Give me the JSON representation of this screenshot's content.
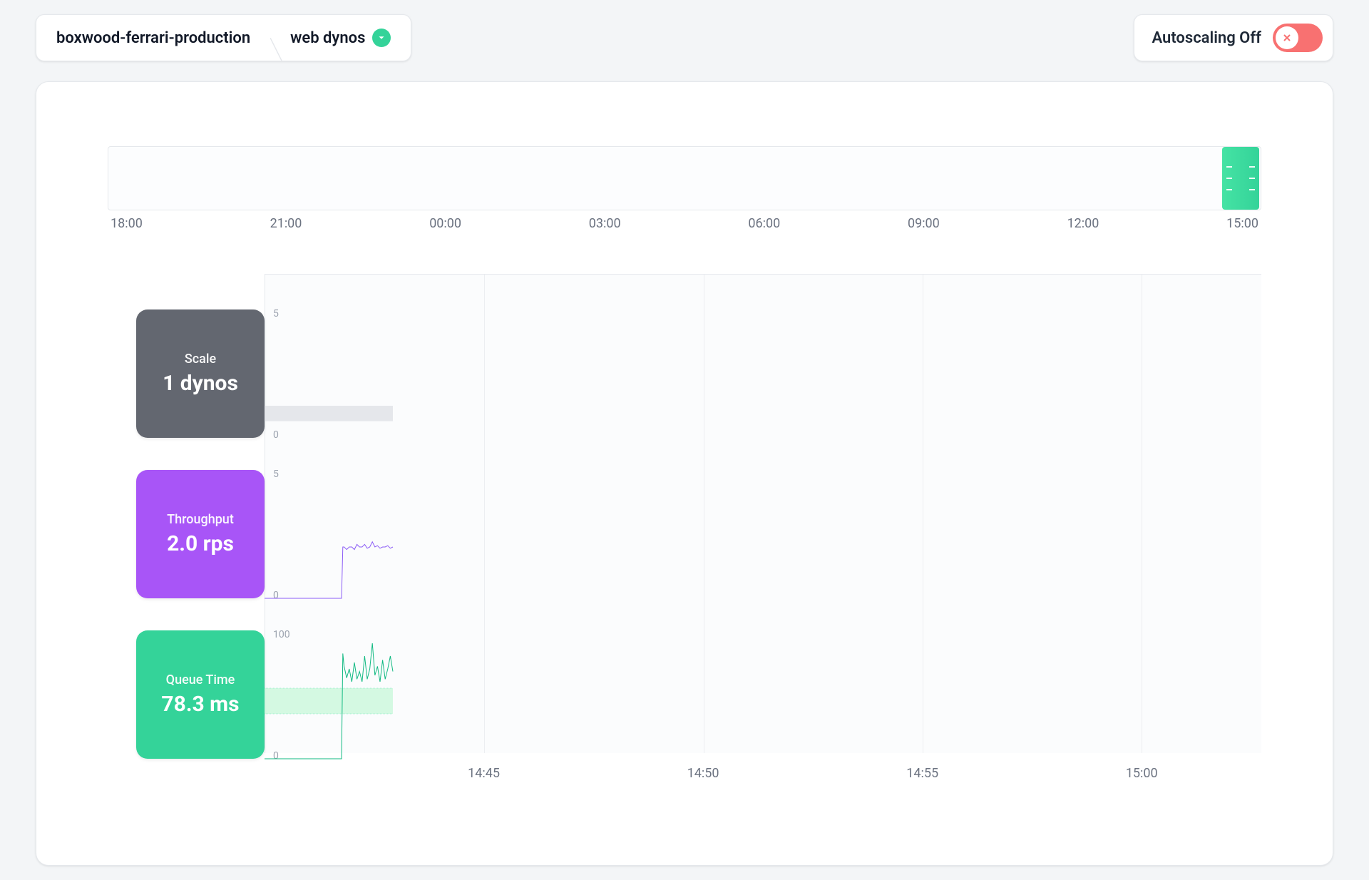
{
  "breadcrumb": {
    "app_name": "boxwood-ferrari-production",
    "page": "web dynos"
  },
  "autoscaling": {
    "label": "Autoscaling Off",
    "enabled": false
  },
  "overview": {
    "tick_labels": [
      "18:00",
      "21:00",
      "00:00",
      "03:00",
      "06:00",
      "09:00",
      "12:00",
      "15:00"
    ]
  },
  "detail": {
    "tick_labels": [
      "14:45",
      "14:50",
      "14:55",
      "15:00"
    ],
    "tick_positions_pct": [
      22,
      44,
      66,
      88
    ]
  },
  "tiles": {
    "scale": {
      "label": "Scale",
      "value": "1 dynos",
      "color": "#636770"
    },
    "throughput": {
      "label": "Throughput",
      "value": "2.0 rps",
      "color": "#A855F7"
    },
    "queue": {
      "label": "Queue Time",
      "value": "78.3 ms",
      "color": "#34D399"
    }
  },
  "yaxis": {
    "scale": {
      "top": "5",
      "bottom": "0"
    },
    "throughput": {
      "top": "5",
      "bottom": "0"
    },
    "queue": {
      "top": "100",
      "bottom": "0"
    }
  },
  "chart_data": [
    {
      "type": "area",
      "name": "Scale",
      "xlabel": "",
      "ylabel": "dynos",
      "ylim": [
        0,
        5
      ],
      "x_range_minutes": [
        "14:40",
        "15:05"
      ],
      "series": [
        {
          "name": "dynos",
          "x": [
            0,
            100
          ],
          "y": [
            1,
            1
          ]
        }
      ]
    },
    {
      "type": "line",
      "name": "Throughput",
      "xlabel": "",
      "ylabel": "rps",
      "ylim": [
        0,
        5
      ],
      "x_range_minutes": [
        "14:40",
        "15:05"
      ],
      "series": [
        {
          "name": "rps",
          "x": [
            0,
            60,
            61,
            62,
            64,
            66,
            68,
            70,
            72,
            74,
            76,
            78,
            80,
            82,
            84,
            86,
            88,
            90,
            92,
            94,
            96,
            98,
            100
          ],
          "y": [
            0,
            0,
            2.0,
            2.0,
            1.9,
            2.0,
            2.0,
            1.9,
            2.1,
            2.0,
            2.0,
            2.1,
            1.95,
            2.0,
            2.2,
            2.0,
            2.05,
            1.95,
            2.0,
            2.0,
            2.05,
            1.95,
            2.0
          ]
        }
      ]
    },
    {
      "type": "line",
      "name": "Queue Time",
      "xlabel": "",
      "ylabel": "ms",
      "ylim": [
        0,
        100
      ],
      "x_range_minutes": [
        "14:40",
        "15:05"
      ],
      "target_band": [
        35,
        55
      ],
      "series": [
        {
          "name": "ms",
          "x": [
            0,
            60,
            61,
            62,
            64,
            66,
            68,
            70,
            72,
            74,
            76,
            78,
            80,
            82,
            84,
            86,
            88,
            90,
            92,
            94,
            96,
            98,
            100
          ],
          "y": [
            0,
            0,
            82,
            72,
            63,
            70,
            60,
            75,
            62,
            68,
            60,
            80,
            62,
            70,
            90,
            65,
            72,
            60,
            77,
            62,
            70,
            80,
            68
          ]
        }
      ]
    }
  ]
}
